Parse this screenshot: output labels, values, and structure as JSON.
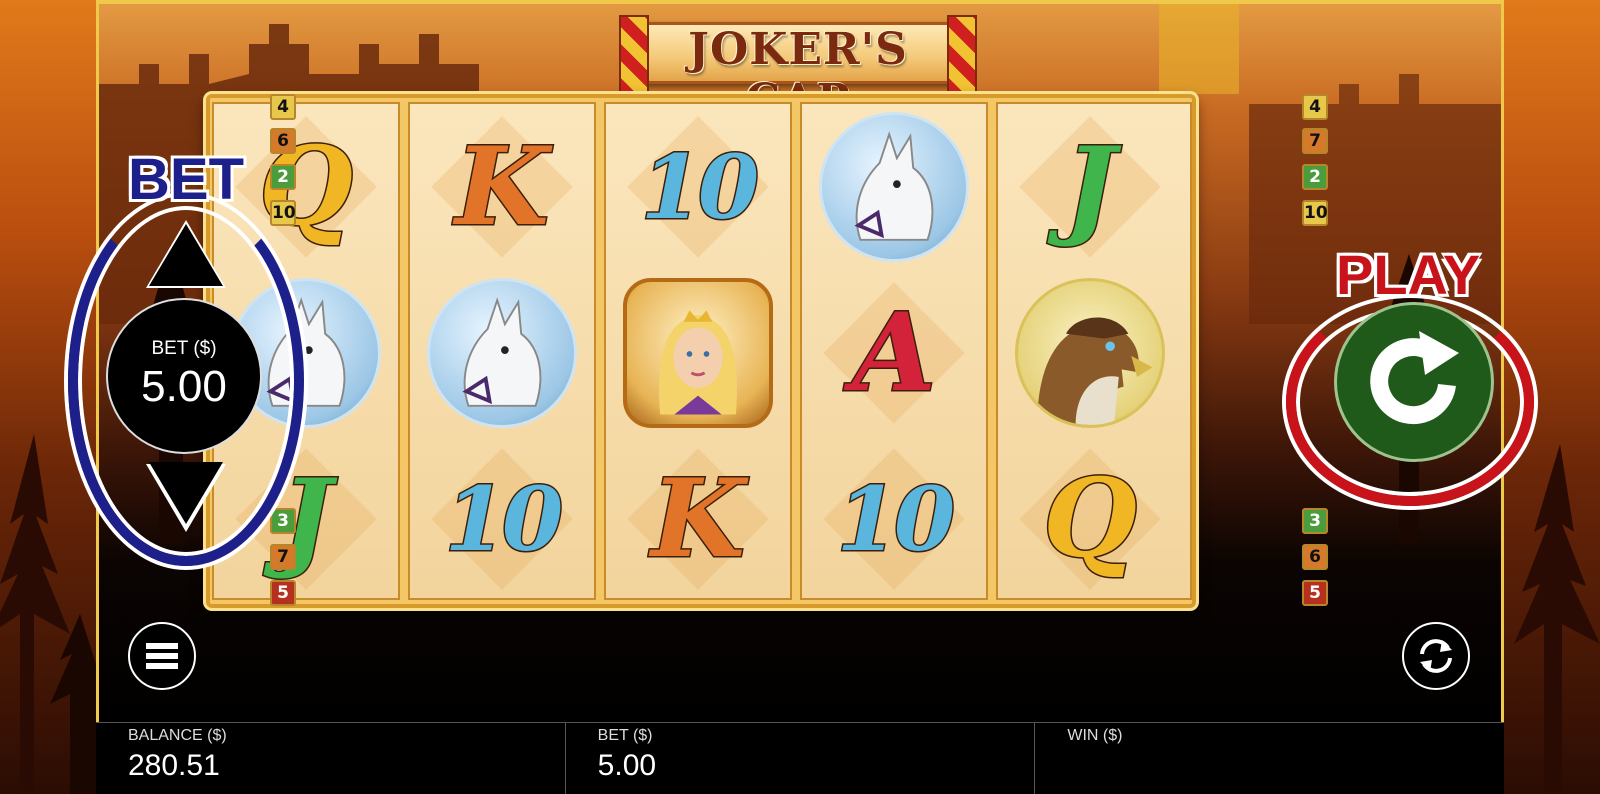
{
  "game": {
    "title": "JOKER'S CAP"
  },
  "bet_control": {
    "heading": "BET",
    "label": "BET ($)",
    "value": "5.00"
  },
  "play": {
    "heading": "PLAY"
  },
  "reels": [
    [
      "Q",
      "horse",
      "J"
    ],
    [
      "K",
      "horse",
      "10"
    ],
    [
      "10",
      "princess",
      "K"
    ],
    [
      "horse",
      "A",
      "10"
    ],
    [
      "J",
      "hawk",
      "Q"
    ]
  ],
  "paylines": {
    "left_top": [
      "4",
      "6",
      "2",
      "10"
    ],
    "left_bottom": [
      "3",
      "7",
      "5"
    ],
    "right_top": [
      "4",
      "7",
      "2",
      "10"
    ],
    "right_bottom": [
      "3",
      "6",
      "5"
    ]
  },
  "status": {
    "balance_label": "BALANCE ($)",
    "balance_value": "280.51",
    "bet_label": "BET ($)",
    "bet_value": "5.00",
    "win_label": "WIN ($)",
    "win_value": ""
  },
  "icons": {
    "menu": "menu-icon",
    "autoplay": "autoplay-icon",
    "spin": "spin-arrow-icon"
  }
}
